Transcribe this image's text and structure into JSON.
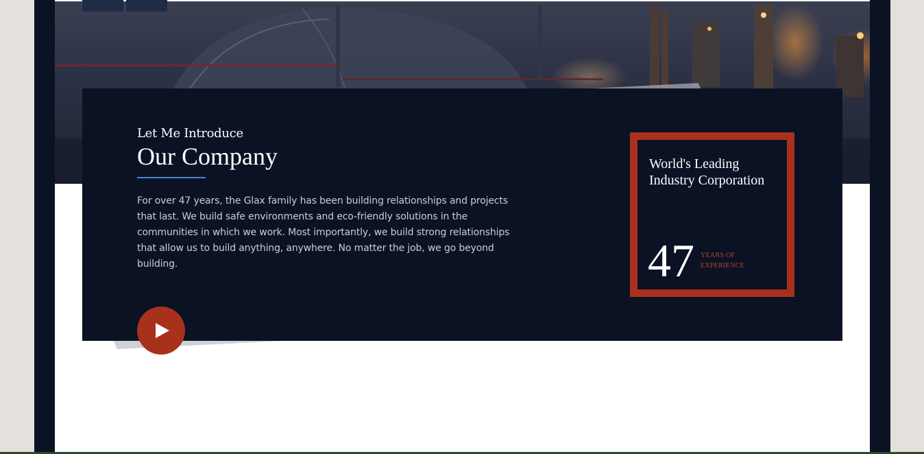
{
  "intro": {
    "kicker": "Let Me Introduce",
    "headline": "Our Company",
    "description": "For over 47 years, the Glax family has been building relationships and projects that last. We build safe environments and eco-friendly solutions in the communities in which we work. Most importantly, we build strong relationships that allow us to build anything, anywhere. No matter the job, we go beyond building.",
    "play_icon": "play-icon"
  },
  "stat": {
    "title": "World's Leading Industry Corporation",
    "number": "47",
    "label": "Years of Experience"
  },
  "colors": {
    "accent_red": "#a8311b",
    "navy": "#0b1224",
    "underline_blue": "#4a86d6"
  }
}
